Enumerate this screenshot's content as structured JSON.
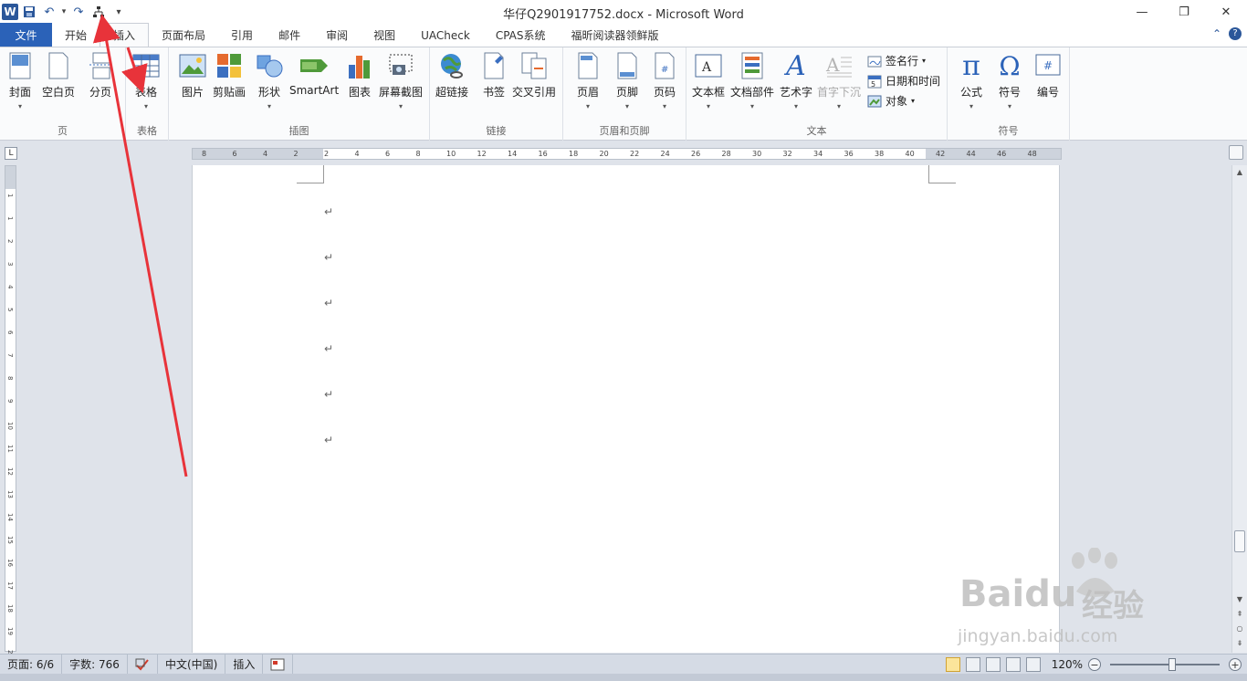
{
  "window": {
    "title": "华仔Q2901917752.docx  -  Microsoft Word",
    "logo_letter": "W",
    "minimize": "—",
    "restore": "❐",
    "close": "✕"
  },
  "qat": {
    "save": "💾",
    "undo": "↶",
    "undo_drop": "▾",
    "redo": "↷",
    "tree": "⊞",
    "customize": "▾"
  },
  "tabs": [
    {
      "label": "文件",
      "kind": "file"
    },
    {
      "label": "开始",
      "kind": "normal"
    },
    {
      "label": "插入",
      "kind": "active"
    },
    {
      "label": "页面布局",
      "kind": "normal"
    },
    {
      "label": "引用",
      "kind": "normal"
    },
    {
      "label": "邮件",
      "kind": "normal"
    },
    {
      "label": "审阅",
      "kind": "normal"
    },
    {
      "label": "视图",
      "kind": "normal"
    },
    {
      "label": "UACheck",
      "kind": "normal"
    },
    {
      "label": "CPAS系统",
      "kind": "normal"
    },
    {
      "label": "福昕阅读器领鲜版",
      "kind": "normal"
    }
  ],
  "tabs_right": {
    "collapse": "⌃",
    "help": "?"
  },
  "ribbon": {
    "groups": {
      "pages": "页",
      "tables": "表格",
      "illustrations": "插图",
      "links": "链接",
      "header_footer": "页眉和页脚",
      "text": "文本",
      "symbols": "符号"
    },
    "buttons": {
      "cover": "封面",
      "blank": "空白页",
      "break": "分页",
      "table": "表格",
      "picture": "图片",
      "clipart": "剪贴画",
      "shapes": "形状",
      "smartart": "SmartArt",
      "chart": "图表",
      "screenshot": "屏幕截图",
      "hyperlink": "超链接",
      "bookmark": "书签",
      "crossref": "交叉引用",
      "header": "页眉",
      "footer": "页脚",
      "pagenum": "页码",
      "textbox": "文本框",
      "quickparts": "文档部件",
      "wordart": "艺术字",
      "dropcap": "首字下沉",
      "signature": "签名行",
      "datetime": "日期和时间",
      "object": "对象",
      "equation": "公式",
      "symbol": "符号",
      "number": "编号"
    },
    "glyphs": {
      "pi": "π",
      "omega": "Ω",
      "hash": "#",
      "A": "A",
      "caret": "▾"
    }
  },
  "ruler": {
    "corner": "L",
    "numbers": [
      "8",
      "6",
      "4",
      "2",
      "2",
      "4",
      "6",
      "8",
      "10",
      "12",
      "14",
      "16",
      "18",
      "20",
      "22",
      "24",
      "26",
      "28",
      "30",
      "32",
      "34",
      "36",
      "38",
      "40",
      "42",
      "44",
      "46",
      "48"
    ],
    "vnumbers": [
      "1",
      "1",
      "2",
      "3",
      "4",
      "5",
      "6",
      "7",
      "8",
      "9",
      "10",
      "11",
      "12",
      "13",
      "14",
      "15",
      "16",
      "17",
      "18",
      "19",
      "20"
    ]
  },
  "document": {
    "paragraph_mark": "↵",
    "paragraph_count": 6
  },
  "statusbar": {
    "page": "页面: 6/6",
    "words": "字数: 766",
    "language": "中文(中国)",
    "mode": "插入",
    "zoom": "120%",
    "zoom_out": "−",
    "zoom_in": "+"
  },
  "watermark": {
    "brand": "Baidu",
    "cn": "经验",
    "url": "jingyan.baidu.com"
  },
  "colors": {
    "accent": "#2b579a",
    "file_tab": "#2b62b8",
    "annotation": "#e8333a"
  }
}
